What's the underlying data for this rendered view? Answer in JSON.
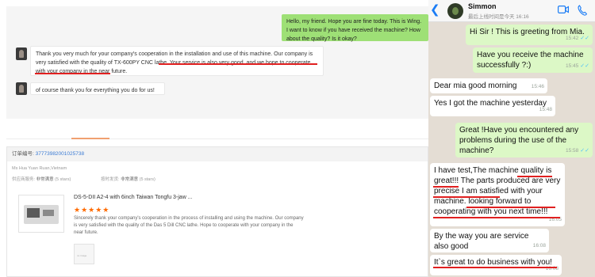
{
  "left_chat": {
    "outgoing_message": "Hello, my friend. Hope you are fine today. This is Wing. I want to know if you have received the machine? How about the quality? Is it okay?",
    "incoming_message_1": "Thank you very much for your company's cooperation in the installation and use of this machine. Our company is very satisfied with the quality of TX-600PY CNC lathe. Your service is also very good, and we hope to cooperate with your company in the near future.",
    "incoming_message_2": "of course thank you for everything you do for us!"
  },
  "order": {
    "number_label": "订单编号:",
    "number": "3777398200102573​8",
    "buyer": "Ms Hua Yuan Ruan,Vietnam",
    "rating_supply_label": "供应商服务:",
    "rating_supply_value": "非常满意",
    "rating_supply_stars": "(5 stars)",
    "rating_delivery_label": "按时发货:",
    "rating_delivery_value": "非常满意",
    "rating_delivery_stars": "(5 stars)",
    "product_title": "DS-5-DII A2-4 with 6inch Taiwan Tongfu 3-jaw ...",
    "stars": "★★★★★",
    "star_count": 5,
    "review": "Sincerely thank your company's cooperation in the process of installing and using the machine. Our company is very satisfied with the quality of the Das 5 Dill CNC lathe. Hope to cooperate with your company in the near future.",
    "thumb_caption": "no image"
  },
  "whatsapp": {
    "contact_name": "Simmon",
    "status": "最后上线时间是今天 16:16",
    "accent": "#1a7cf5",
    "messages": [
      {
        "dir": "out",
        "text": "Hi Sir ! This is greeting from Mia.",
        "time": "15:42"
      },
      {
        "dir": "out",
        "text": "Have you receive the machine successfully ?:)",
        "time": "15:45"
      },
      {
        "dir": "in",
        "text": "Dear mia good morning",
        "time": "15:46"
      },
      {
        "dir": "in",
        "text": "Yes I got the machine yesterday",
        "time": "15:48"
      },
      {
        "dir": "out",
        "text": "Great !Have you encountered any problems during the use of the machine?",
        "time": "15:58"
      },
      {
        "dir": "in",
        "text": "I have test,The machine quality is great!!! The parts produced are very precise I am satisfied with your machine. looking forward to cooperating with you next time!!!",
        "time": "16:05"
      },
      {
        "dir": "in",
        "text": "By the way you are service also good",
        "time": "16:08"
      },
      {
        "dir": "in",
        "text": "It`s great to do business with you!",
        "time": "16:08"
      }
    ]
  }
}
